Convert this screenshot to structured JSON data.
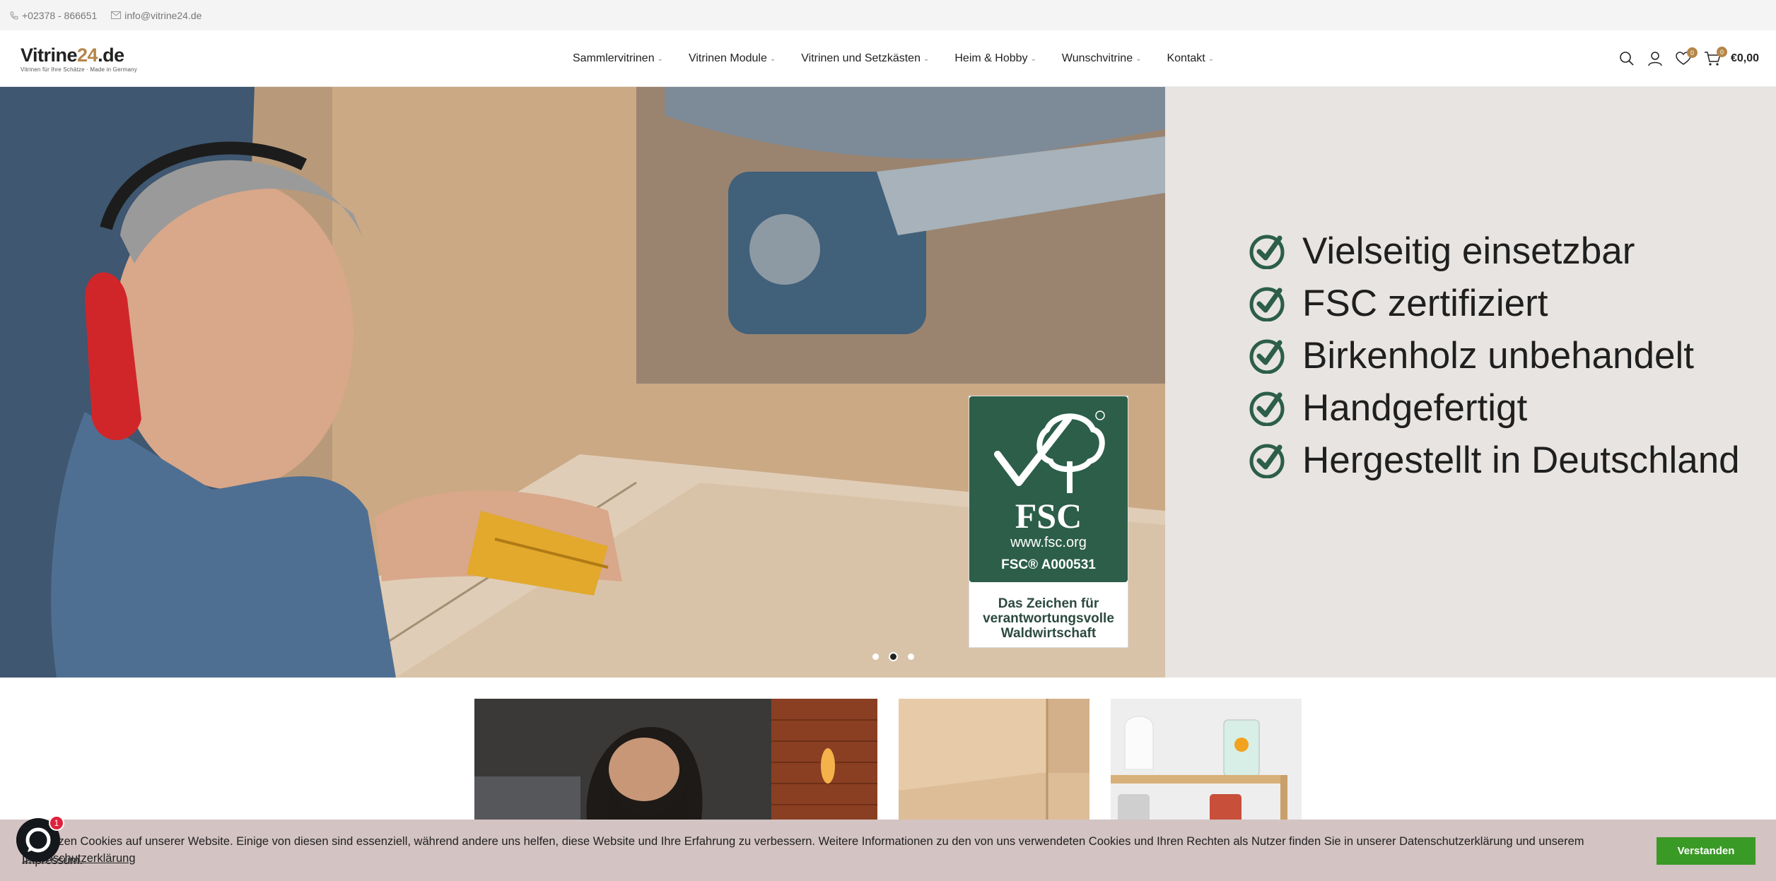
{
  "topbar": {
    "phone": "+02378 - 866651",
    "email": "info@vitrine24.de"
  },
  "logo": {
    "brand_main": "Vitrine",
    "brand_accent": "24",
    "brand_suffix": ".de",
    "tagline": "Vitrinen für Ihre Schätze · Made in Germany"
  },
  "nav": {
    "items": [
      {
        "label": "Sammlervitrinen"
      },
      {
        "label": "Vitrinen Module"
      },
      {
        "label": "Vitrinen und Setzkästen"
      },
      {
        "label": "Heim & Hobby"
      },
      {
        "label": "Wunschvitrine"
      },
      {
        "label": "Kontakt"
      }
    ]
  },
  "header_icons": {
    "wishlist_count": "0",
    "cart_count": "0",
    "cart_total": "€0,00"
  },
  "hero": {
    "checklist": [
      "Vielseitig einsetzbar",
      "FSC zertifiziert",
      "Birkenholz unbehandelt",
      "Handgefertigt",
      "Hergestellt in Deutschland"
    ],
    "fsc": {
      "word": "FSC",
      "url": "www.fsc.org",
      "code": "FSC® A000531",
      "caption": "Das Zeichen für verantwortungsvolle Waldwirtschaft"
    },
    "slide_active": 2,
    "slide_count": 3
  },
  "cookie": {
    "text": "Wir setzen Cookies auf unserer Website. Einige von diesen sind essenziell, während andere uns helfen, diese Website und Ihre Erfahrung zu verbessern. Weitere Informationen zu den von uns verwendeten Cookies und Ihren Rechten als Nutzer finden Sie in unserer Datenschutzerklärung und unserem Impressum.",
    "link": "Datenschutzerklärung",
    "button": "Verstanden"
  },
  "chat": {
    "badge": "1"
  },
  "colors": {
    "accent": "#b5864a",
    "fsc_green": "#2c5e4a",
    "check_green": "#2c5e4a",
    "cookie_bg": "#d3c3c3",
    "button_green": "#3a9a26"
  }
}
